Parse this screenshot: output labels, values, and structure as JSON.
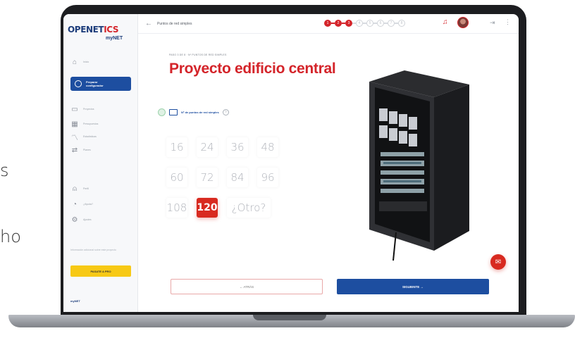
{
  "background": {
    "fragment_s": "s",
    "fragment_ho": "ho"
  },
  "sidebar": {
    "logo_main": "OPENET",
    "logo_red": "ICS",
    "logo_sub": "myNET",
    "items": [
      {
        "label": "Inicio",
        "icon": "home-icon"
      },
      {
        "label": "Proyectos",
        "icon": "folder-icon"
      },
      {
        "label": "Presupuestos",
        "icon": "calculator-icon"
      },
      {
        "label": "Estadísticas",
        "icon": "chart-icon"
      },
      {
        "label": "Planes",
        "icon": "plans-icon"
      },
      {
        "label": "Perfil",
        "icon": "user-icon"
      },
      {
        "label": "¿Ayuda?",
        "icon": "chat-icon"
      },
      {
        "label": "Ajustes",
        "icon": "settings-icon"
      }
    ],
    "active": {
      "line1": "Preparar",
      "line2": "configurador"
    },
    "note": "Información adicional sobre este proyecto",
    "cta": "PASATE A PRO",
    "footer": "myNET"
  },
  "topbar": {
    "title": "Puntos de red simples",
    "steps_total": 8,
    "steps_done": 3,
    "step_numbers": [
      "1",
      "2",
      "3",
      "4",
      "5",
      "6",
      "7",
      "8"
    ]
  },
  "main": {
    "breadcrumb": "PASO 3 DE 8 · Nº PUNTOS DE RED SIMPLES",
    "title": "Proyecto edificio central",
    "question": "Nº de puntos de red simples",
    "help": "?",
    "options": [
      "16",
      "24",
      "36",
      "48",
      "60",
      "72",
      "84",
      "96",
      "108",
      "120",
      "¿Otro?"
    ],
    "selected": "120"
  },
  "actions": {
    "back": "←  ATRÁS",
    "next": "SIGUIENTE  →"
  },
  "colors": {
    "brand_red": "#d4242a",
    "brand_blue": "#1d4ea0",
    "cta_yellow": "#f7c915"
  }
}
